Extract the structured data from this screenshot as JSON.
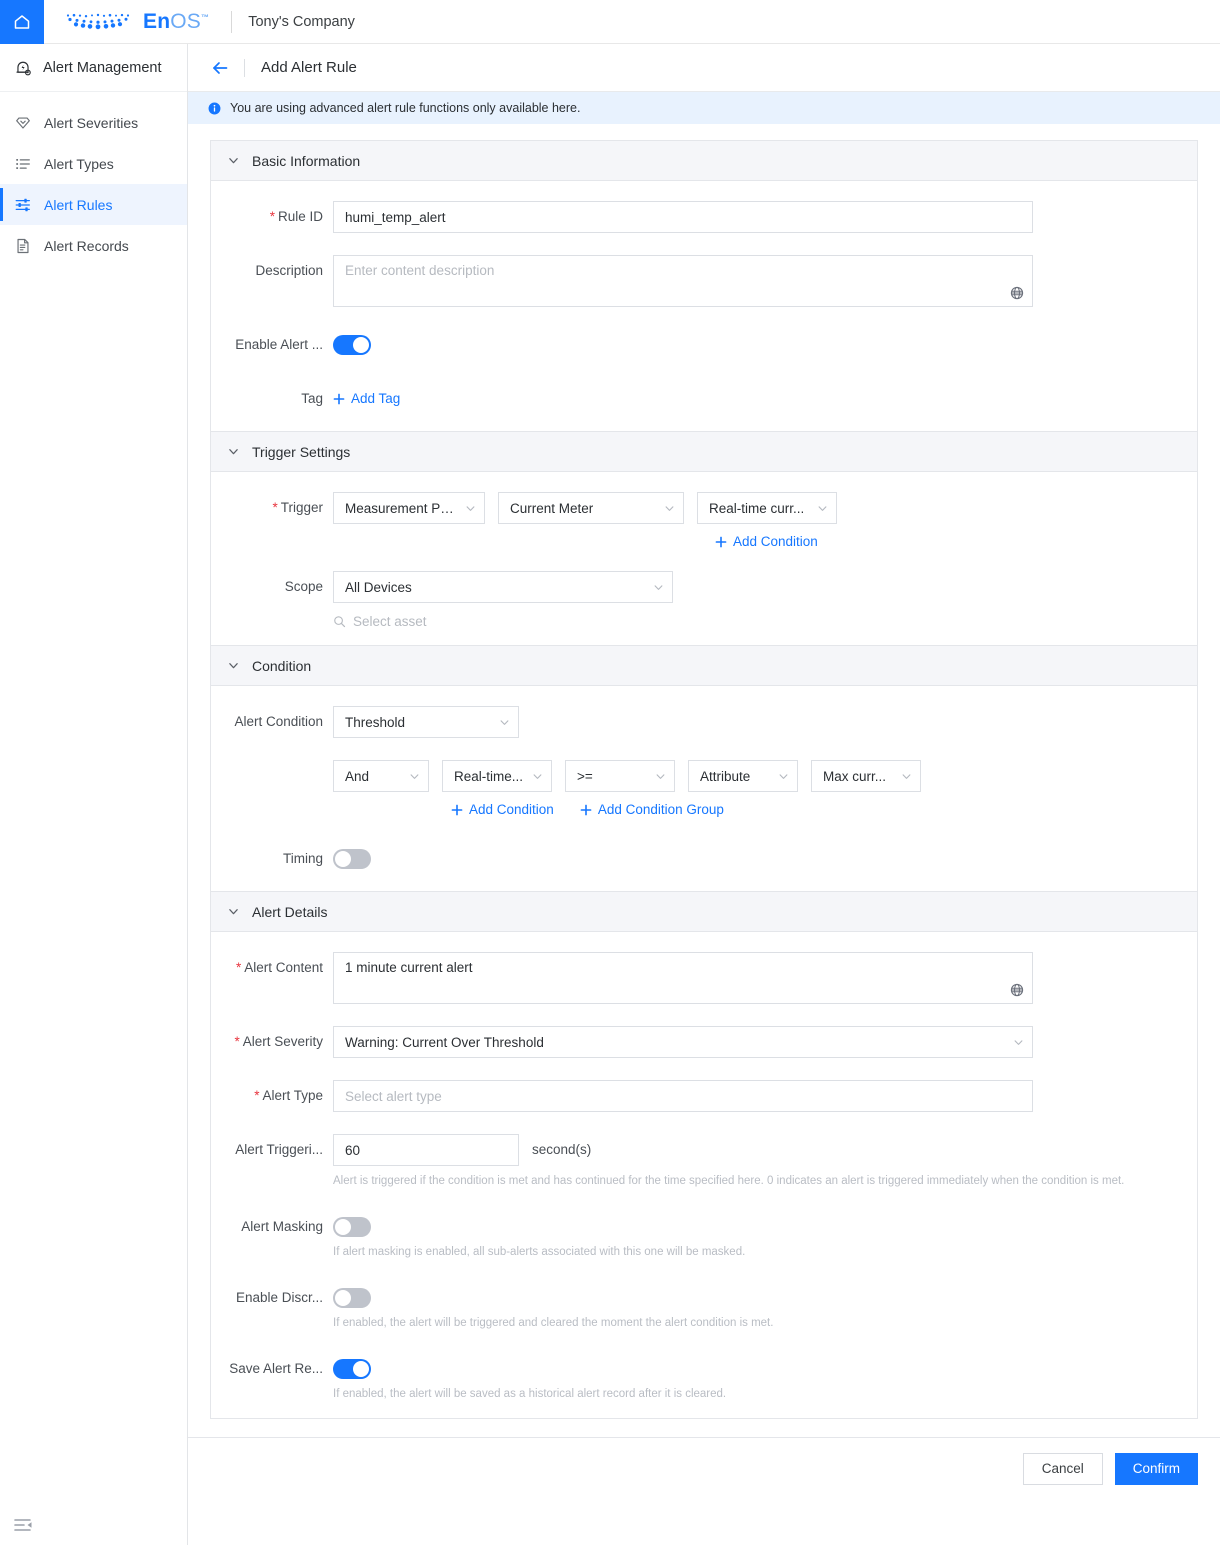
{
  "topbar": {
    "home_icon": "home-icon",
    "brand_en": "En",
    "brand_os": "OS",
    "brand_tm": "™",
    "company": "Tony's Company"
  },
  "sidebar": {
    "header": {
      "icon": "alert-bell-icon",
      "label": "Alert Management"
    },
    "items": [
      {
        "icon": "severity-diamond-icon",
        "label": "Alert Severities",
        "active": false
      },
      {
        "icon": "list-icon",
        "label": "Alert Types",
        "active": false
      },
      {
        "icon": "sliders-icon",
        "label": "Alert Rules",
        "active": true
      },
      {
        "icon": "document-icon",
        "label": "Alert Records",
        "active": false
      }
    ],
    "collapse_icon": "collapse-sidebar-icon"
  },
  "page": {
    "back_icon": "back-arrow-icon",
    "title": "Add Alert Rule",
    "info_banner": "You are using advanced alert rule functions only available here."
  },
  "basic_information": {
    "section_title": "Basic Information",
    "rule_id": {
      "label": "Rule ID",
      "required": true,
      "value": "humi_temp_alert"
    },
    "description": {
      "label": "Description",
      "required": false,
      "value": "",
      "placeholder": "Enter content description",
      "globe_icon": "globe-translate-icon"
    },
    "enable_alert": {
      "label": "Enable Alert ...",
      "required": false,
      "on": true
    },
    "tag": {
      "label": "Tag",
      "add_label": "Add Tag"
    }
  },
  "trigger_settings": {
    "section_title": "Trigger Settings",
    "trigger": {
      "label": "Trigger",
      "required": true,
      "type_value": "Measurement Point",
      "model_value": "Current Meter",
      "point_value": "Real-time curr...",
      "add_condition_label": "Add Condition"
    },
    "scope": {
      "label": "Scope",
      "value": "All Devices",
      "asset_placeholder": "Select asset",
      "search_icon": "search-icon"
    }
  },
  "condition": {
    "section_title": "Condition",
    "alert_condition": {
      "label": "Alert Condition",
      "value": "Threshold"
    },
    "expression": {
      "logic": "And",
      "metric": "Real-time...",
      "operator": ">=",
      "compare_type": "Attribute",
      "compare_value": "Max curr..."
    },
    "add_condition_label": "Add Condition",
    "add_condition_group_label": "Add Condition Group",
    "timing": {
      "label": "Timing",
      "on": false
    }
  },
  "alert_details": {
    "section_title": "Alert Details",
    "alert_content": {
      "label": "Alert Content",
      "required": true,
      "value": "1 minute current alert",
      "globe_icon": "globe-translate-icon"
    },
    "alert_severity": {
      "label": "Alert Severity",
      "required": true,
      "value": "Warning: Current Over Threshold"
    },
    "alert_type": {
      "label": "Alert Type",
      "required": true,
      "value": "",
      "placeholder": "Select alert type"
    },
    "alert_triggering": {
      "label": "Alert Triggeri...",
      "value": "60",
      "unit": "second(s)",
      "hint": "Alert is triggered if the condition is met and has continued for the time specified here. 0 indicates an alert is triggered immediately when the condition is met."
    },
    "alert_masking": {
      "label": "Alert Masking",
      "on": false,
      "hint": "If alert masking is enabled, all sub-alerts associated with this one will be masked."
    },
    "enable_discrete": {
      "label": "Enable Discr...",
      "on": false,
      "hint": "If enabled, the alert will be triggered and cleared the moment the alert condition is met."
    },
    "save_alert_record": {
      "label": "Save Alert Re...",
      "on": true,
      "hint": "If enabled, the alert will be saved as a historical alert record after it is cleared."
    }
  },
  "footer": {
    "cancel_label": "Cancel",
    "confirm_label": "Confirm"
  },
  "colors": {
    "accent": "#1677ff",
    "required_star": "#e8353f",
    "info_banner_bg": "#e8f2fe",
    "section_head_bg": "#f5f6f9",
    "switch_off": "#bfc3cb"
  }
}
